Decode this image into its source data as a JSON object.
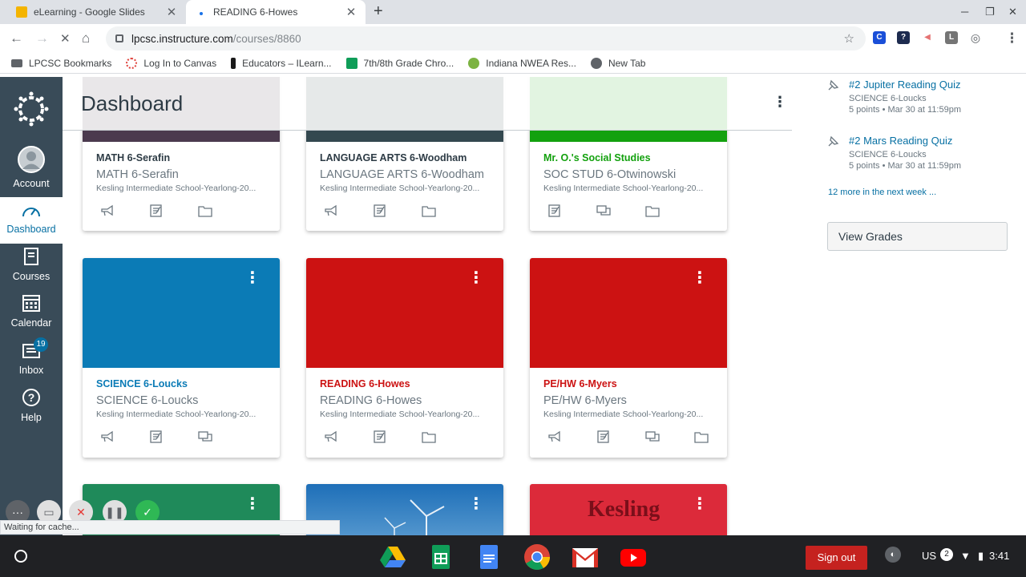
{
  "browser": {
    "tabs": [
      {
        "title": "eLearning - Google Slides",
        "active": false
      },
      {
        "title": "READING 6-Howes",
        "active": true
      }
    ],
    "url_host": "lpcsc.instructure.com",
    "url_path": "/courses/8860",
    "bookmarks": [
      {
        "label": "LPCSC Bookmarks",
        "icon": "folder-icon"
      },
      {
        "label": "Log In to Canvas",
        "icon": "canvas-icon"
      },
      {
        "label": "Educators – ILearn...",
        "icon": "pen-icon"
      },
      {
        "label": "7th/8th Grade Chro...",
        "icon": "sheets-icon"
      },
      {
        "label": "Indiana NWEA Res...",
        "icon": "nwea-icon"
      },
      {
        "label": "New Tab",
        "icon": "globe-icon"
      }
    ],
    "status_text": "Waiting for cache..."
  },
  "nav": {
    "account": "Account",
    "dashboard": "Dashboard",
    "courses": "Courses",
    "calendar": "Calendar",
    "inbox": "Inbox",
    "inbox_badge": "19",
    "help": "Help"
  },
  "dashboard": {
    "title": "Dashboard"
  },
  "cards": [
    {
      "code": "MATH 6-Serafin",
      "name": "MATH 6-Serafin",
      "term": "Kesling Intermediate School-Yearlong-20...",
      "color": "#4b3a4e",
      "code_color": "#2d3b45"
    },
    {
      "code": "LANGUAGE ARTS 6-Woodham",
      "name": "LANGUAGE ARTS 6-Woodham",
      "term": "Kesling Intermediate School-Yearlong-20...",
      "color": "#33484f",
      "code_color": "#2d3b45"
    },
    {
      "code": "Mr. O.'s Social Studies",
      "name": "SOC STUD 6-Otwinowski",
      "term": "Kesling Intermediate School-Yearlong-20...",
      "color": "#13a10e",
      "code_color": "#13a10e"
    },
    {
      "code": "SCIENCE 6-Loucks",
      "name": "SCIENCE 6-Loucks",
      "term": "Kesling Intermediate School-Yearlong-20...",
      "color": "#0b7bb6",
      "code_color": "#0b7bb6"
    },
    {
      "code": "READING 6-Howes",
      "name": "READING 6-Howes",
      "term": "Kesling Intermediate School-Yearlong-20...",
      "color": "#cc1212",
      "code_color": "#cc1212"
    },
    {
      "code": "PE/HW 6-Myers",
      "name": "PE/HW 6-Myers",
      "term": "Kesling Intermediate School-Yearlong-20...",
      "color": "#cc1212",
      "code_color": "#cc1212"
    },
    {
      "color": "#1f8a5a"
    },
    {
      "color": "#2a7fc4"
    },
    {
      "color": "#dc2a3a",
      "logo_text": "Kesling"
    }
  ],
  "todo": [
    {
      "title": "#2 Jupiter Reading Quiz",
      "course": "SCIENCE 6-Loucks",
      "meta": "5 points • Mar 30 at 11:59pm"
    },
    {
      "title": "#2 Mars Reading Quiz",
      "course": "SCIENCE 6-Loucks",
      "meta": "5 points • Mar 30 at 11:59pm"
    }
  ],
  "more_link": "12 more in the next week ...",
  "view_grades": "View Grades",
  "shelf": {
    "sign_out": "Sign out",
    "locale": "US",
    "notif_count": "2",
    "time": "3:41"
  }
}
